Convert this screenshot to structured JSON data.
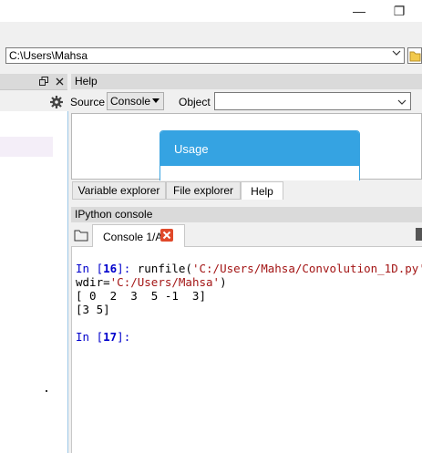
{
  "window": {
    "restore_glyph": "❐",
    "minimize_glyph": "—"
  },
  "path": {
    "value": "C:\\Users\\Mahsa",
    "arrow": "⌵"
  },
  "left": {
    "undock_glyph": "🗗",
    "close_glyph": "✕"
  },
  "help": {
    "title": "Help",
    "source_label": "Source",
    "source_value": "Console",
    "object_label": "Object",
    "object_value": "",
    "usage_title": "Usage",
    "tabs": [
      "Variable explorer",
      "File explorer",
      "Help"
    ],
    "active_tab": "Help"
  },
  "console": {
    "title": "IPython console",
    "tab_label": "Console 1/A",
    "lines": {
      "l1_prompt_a": "In [",
      "l1_num": "16",
      "l1_prompt_b": "]: ",
      "l1_code": "runfile(",
      "l1_str": "'C:/Users/Mahsa/Convolution_1D.py'",
      "l1_end": ",",
      "l2_code": "wdir=",
      "l2_str": "'C:/Users/Mahsa'",
      "l2_end": ")",
      "l3": "[ 0  2  3  5 -1  3]",
      "l4": "[3 5]",
      "l5_prompt_a": "In [",
      "l5_num": "17",
      "l5_prompt_b": "]:"
    }
  },
  "colors": {
    "accent": "#35a3e2",
    "prompt": "#0000cc",
    "string": "#a31515",
    "close_badge": "#e0492a"
  }
}
